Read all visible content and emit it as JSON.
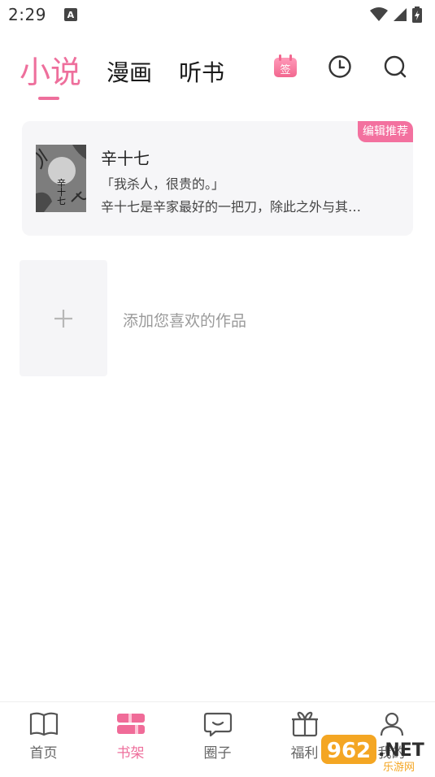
{
  "status_bar": {
    "time": "2:29",
    "notification_letter": "A"
  },
  "top_tabs": {
    "novel": "小说",
    "comic": "漫画",
    "audio": "听书",
    "signin_badge": "签"
  },
  "featured": {
    "badge": "编辑推荐",
    "title": "辛十七",
    "quote": "「我杀人，很贵的。」",
    "description": "辛十七是辛家最好的一把刀，除此之外与其…",
    "cover_text": "辛十七"
  },
  "add_book": {
    "label": "添加您喜欢的作品"
  },
  "bottom_nav": [
    {
      "label": "首页"
    },
    {
      "label": "书架"
    },
    {
      "label": "圈子"
    },
    {
      "label": "福利"
    },
    {
      "label": "我的"
    }
  ],
  "watermark": {
    "brand": "962",
    "suffix": ".NET",
    "sub": "乐游网"
  },
  "colors": {
    "accent": "#ee6f9c",
    "badge": "#f3719f"
  }
}
